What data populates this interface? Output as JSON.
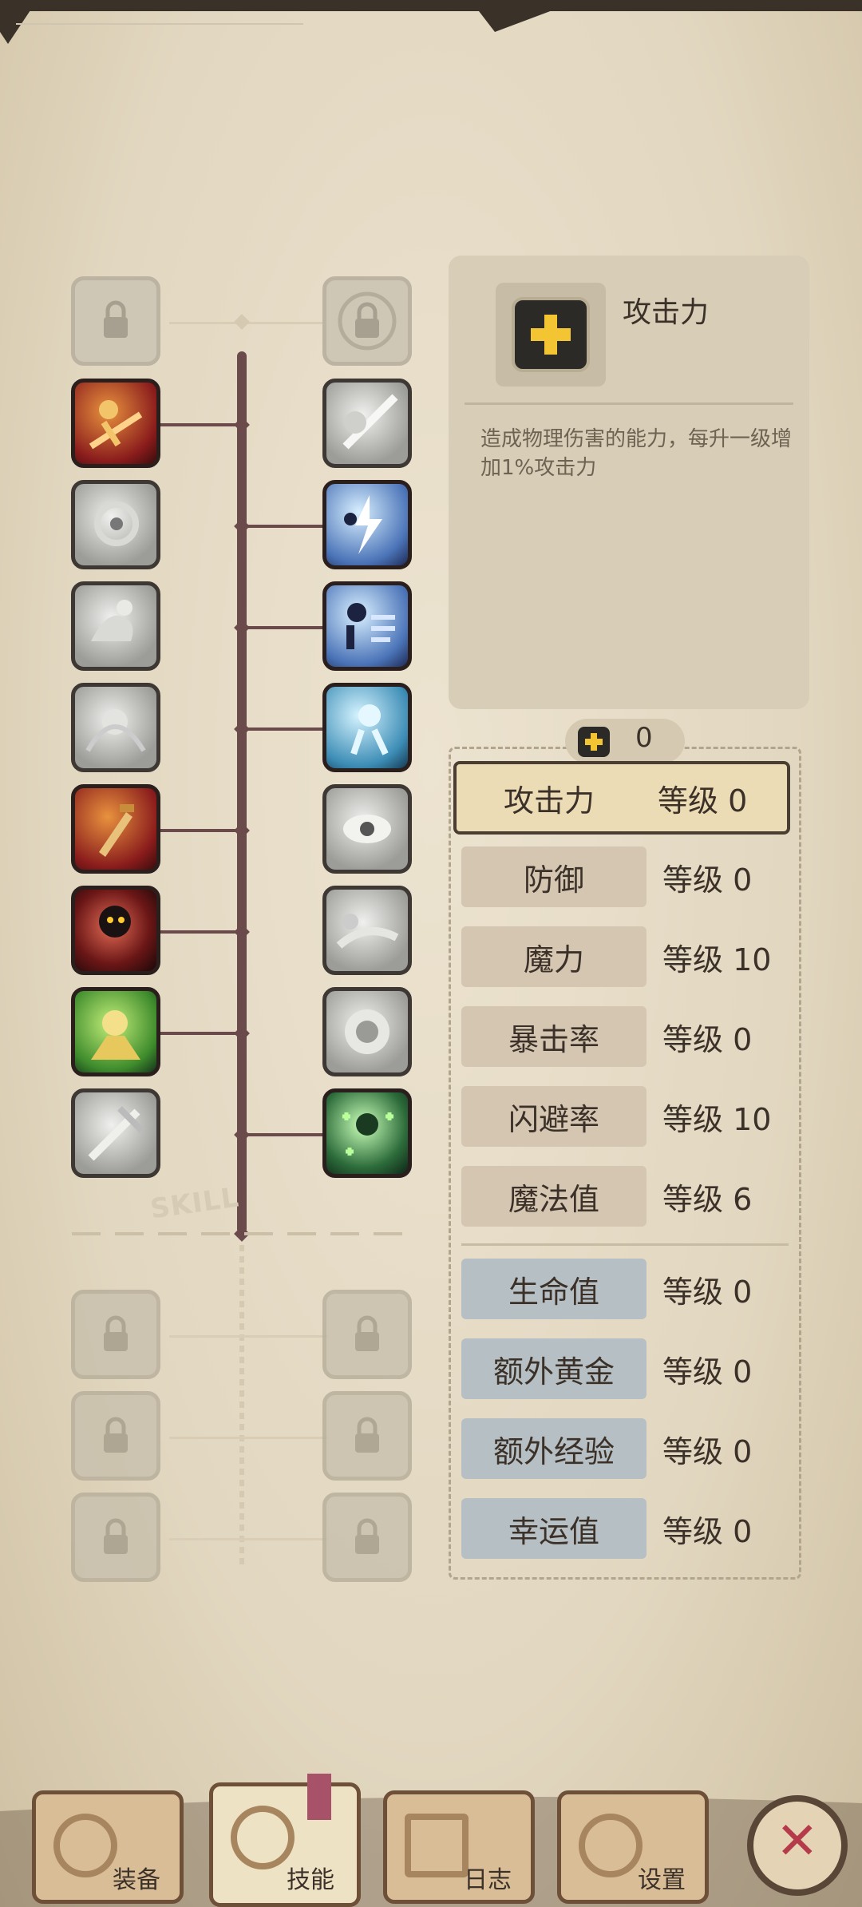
{
  "info": {
    "title": "攻击力",
    "description": "造成物理伤害的能力，每升一级增加1%攻击力"
  },
  "points": {
    "value": "0"
  },
  "stats": [
    {
      "name": "攻击力",
      "level": "等级 0",
      "selected": true
    },
    {
      "name": "防御",
      "level": "等级 0"
    },
    {
      "name": "魔力",
      "level": "等级 10"
    },
    {
      "name": "暴击率",
      "level": "等级 0"
    },
    {
      "name": "闪避率",
      "level": "等级 10"
    },
    {
      "name": "魔法值",
      "level": "等级 6"
    },
    {
      "name": "生命值",
      "level": "等级 0"
    },
    {
      "name": "额外黄金",
      "level": "等级 0"
    },
    {
      "name": "额外经验",
      "level": "等级 0"
    },
    {
      "name": "幸运值",
      "level": "等级 0"
    }
  ],
  "skill_tree": {
    "label": "SKILL"
  },
  "tabs": [
    {
      "label": "装备"
    },
    {
      "label": "技能"
    },
    {
      "label": "日志"
    },
    {
      "label": "设置"
    }
  ],
  "close_icon": "close-icon",
  "colors": {
    "accent_dark": "#6b4a4b",
    "panel": "#d8cdb6",
    "close": "#b53a4a"
  }
}
